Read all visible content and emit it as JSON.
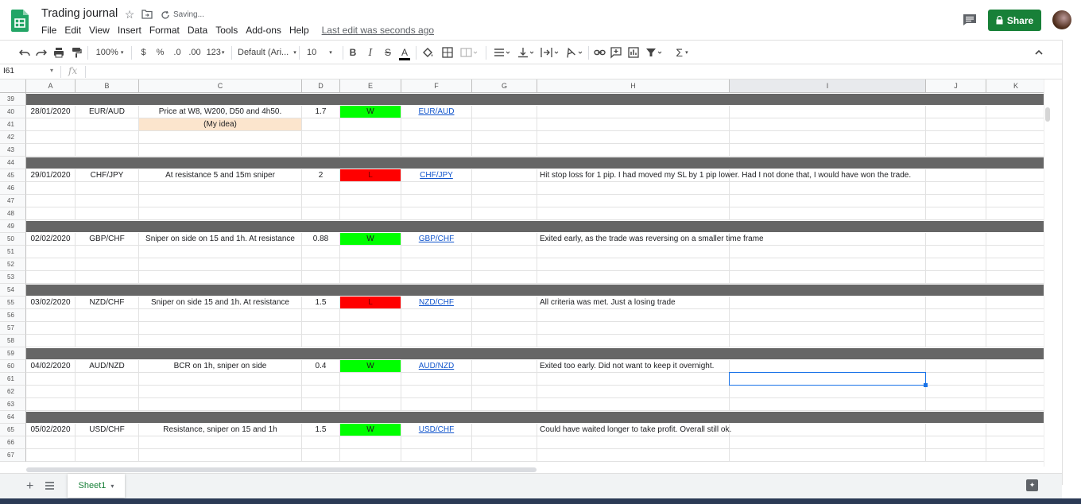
{
  "app": {
    "doc_title": "Trading journal",
    "saving_status": "Saving...",
    "last_edit": "Last edit was seconds ago",
    "share_label": "Share",
    "menu": [
      "File",
      "Edit",
      "View",
      "Insert",
      "Format",
      "Data",
      "Tools",
      "Add-ons",
      "Help"
    ]
  },
  "toolbar": {
    "zoom": "100%",
    "currency": "$",
    "percent": "%",
    "dec_less": ".0",
    "dec_more": ".00",
    "number_format": "123",
    "font": "Default (Ari...",
    "font_size": "10",
    "bold": "B",
    "italic": "I",
    "strike": "S",
    "text_color": "A"
  },
  "formula_bar": {
    "cell_ref": "I61",
    "fx": "fx"
  },
  "columns": [
    "A",
    "B",
    "C",
    "D",
    "E",
    "F",
    "G",
    "H",
    "I",
    "J",
    "K"
  ],
  "row_numbers": [
    "39",
    "40",
    "41",
    "42",
    "43",
    "44",
    "45",
    "46",
    "47",
    "48",
    "49",
    "50",
    "51",
    "52",
    "53",
    "54",
    "55",
    "56",
    "57",
    "58",
    "59",
    "60",
    "61",
    "62",
    "63",
    "64",
    "65",
    "66",
    "67"
  ],
  "trades": [
    {
      "row": "40",
      "date": "28/01/2020",
      "pair": "EUR/AUD",
      "setup": "Price at W8, W200, D50 and 4h50.",
      "rr": "1.7",
      "result": "W",
      "link": "EUR/AUD",
      "notes": ""
    },
    {
      "row": "45",
      "date": "29/01/2020",
      "pair": "CHF/JPY",
      "setup": "At resistance 5 and 15m sniper",
      "rr": "2",
      "result": "L",
      "link": "CHF/JPY",
      "notes": "Hit stop loss for 1 pip. I had moved my SL by 1 pip lower. Had I not done that, I would have won the trade."
    },
    {
      "row": "50",
      "date": "02/02/2020",
      "pair": "GBP/CHF",
      "setup": "Sniper on side on 15 and 1h. At resistance",
      "rr": "0.88",
      "result": "W",
      "link": "GBP/CHF",
      "notes": "Exited early, as the trade was reversing on a smaller time frame"
    },
    {
      "row": "55",
      "date": "03/02/2020",
      "pair": "NZD/CHF",
      "setup": "Sniper on side 15 and 1h. At resistance",
      "rr": "1.5",
      "result": "L",
      "link": "NZD/CHF",
      "notes": "All criteria was met. Just a losing trade"
    },
    {
      "row": "60",
      "date": "04/02/2020",
      "pair": "AUD/NZD",
      "setup": "BCR on 1h, sniper on side",
      "rr": "0.4",
      "result": "W",
      "link": "AUD/NZD",
      "notes": "Exited too early. Did not want to keep it overnight."
    },
    {
      "row": "65",
      "date": "05/02/2020",
      "pair": "USD/CHF",
      "setup": "Resistance, sniper on 15 and 1h",
      "rr": "1.5",
      "result": "W",
      "link": "USD/CHF",
      "notes": "Could have waited longer to take profit. Overall still ok."
    }
  ],
  "idea_note": {
    "row": "41",
    "text": "(My idea)"
  },
  "separator_rows": [
    "39",
    "44",
    "49",
    "54",
    "59",
    "64"
  ],
  "selected_cell": {
    "column": "I",
    "row": "61"
  },
  "sheet_tab": "Sheet1",
  "colors": {
    "win": "#00ff00",
    "loss": "#ff0000",
    "separator": "#666666",
    "idea": "#fce5cd",
    "share": "#188038",
    "selection": "#1a73e8"
  }
}
